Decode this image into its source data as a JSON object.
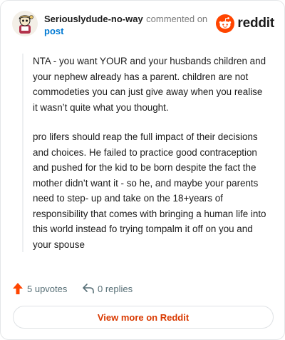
{
  "comment": {
    "username": "Seriouslydude-no-way",
    "action": "commented on",
    "post_link": "post",
    "paragraphs": [
      "NTA - you want YOUR and your husbands children and your nephew already has a parent. children are not commodeties you can just give away when you realise it wasn’t quite what you thought.",
      "pro lifers should reap the full impact of their decisions and choices. He failed to practice good contraception and pushed for the kid to be born despite the fact the mother didn’t want it - so he, and maybe your parents need to step- up and take on the 18+years of responsibility that comes with bringing a human life into this world instead fo trying tompalm it off on you and your spouse"
    ]
  },
  "brand": {
    "name": "reddit",
    "icon": "reddit-snoo-icon",
    "color": "#ff4500"
  },
  "footer": {
    "upvotes_label": "5 upvotes",
    "replies_label": "0 replies",
    "upvote_icon": "upvote-arrow-icon",
    "reply_icon": "reply-arrow-icon",
    "upvote_color": "#ff4500"
  },
  "cta": {
    "label": "View more on Reddit",
    "color": "#d93900"
  }
}
